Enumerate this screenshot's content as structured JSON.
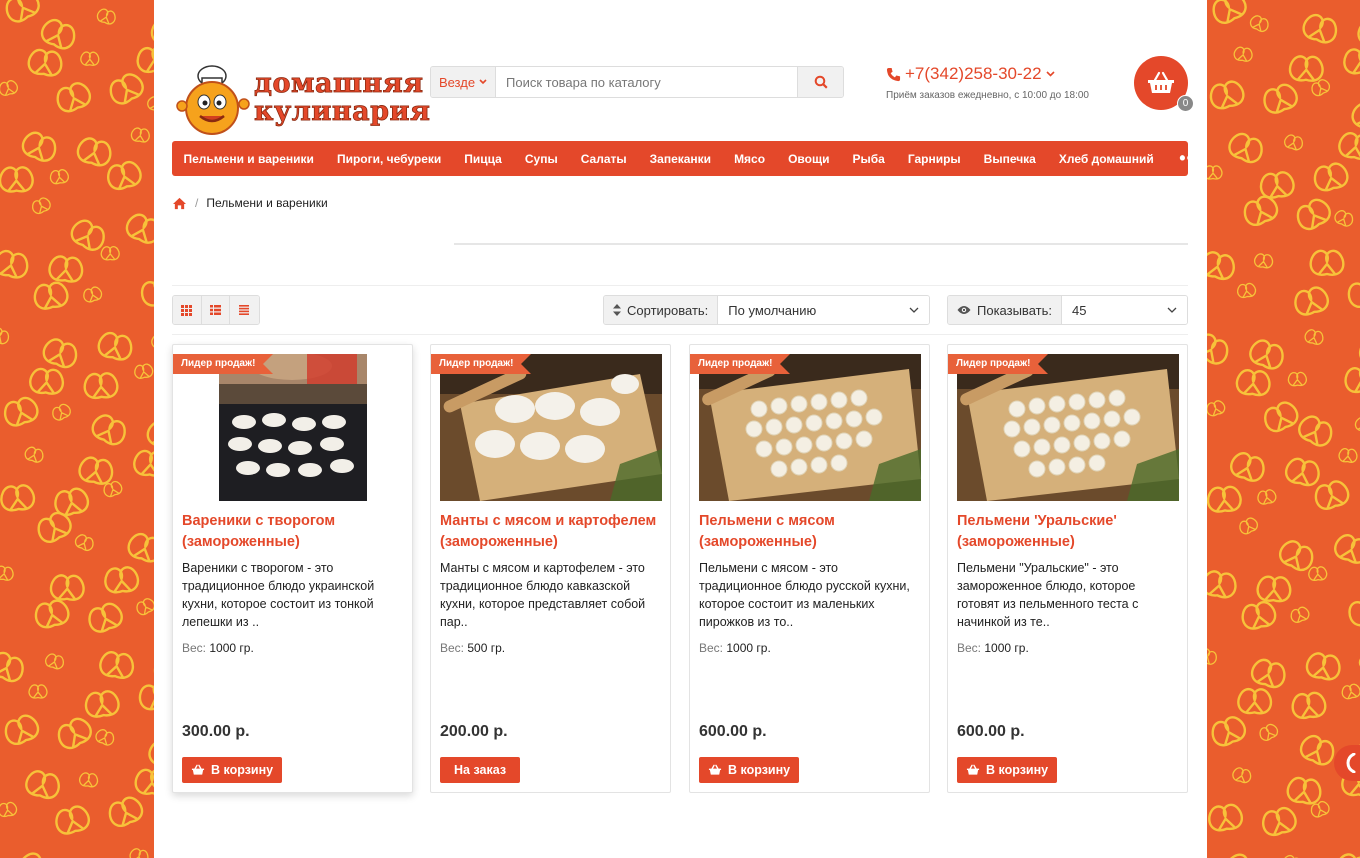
{
  "brand": {
    "logo_line1": "домашняя",
    "logo_line2": "кулинария",
    "accent_color": "#e4482a",
    "background_color": "#ea5d2d"
  },
  "search": {
    "scope": "Везде",
    "placeholder": "Поиск товара по каталогу",
    "icon": "search-icon"
  },
  "contact": {
    "phone": "+7(342)258-30-22",
    "hours": "Приём заказов ежедневно, с 10:00 до 18:00"
  },
  "cart": {
    "count": "0",
    "icon": "basket-icon"
  },
  "menu": {
    "items": [
      "Пельмени и вареники",
      "Пироги, чебуреки",
      "Пицца",
      "Супы",
      "Салаты",
      "Запеканки",
      "Мясо",
      "Овощи",
      "Рыба",
      "Гарниры",
      "Выпечка",
      "Хлеб домашний"
    ],
    "more": "•••"
  },
  "breadcrumb": {
    "current": "Пельмени и вареники"
  },
  "toolbar": {
    "sort_label": "Сортировать:",
    "sort_value": "По умолчанию",
    "show_label": "Показывать:",
    "show_value": "45"
  },
  "products": [
    {
      "badge": "Лидер продаж!",
      "name": "Вареники с творогом (замороженные)",
      "desc": "Вареники с творогом - это традиционное блюдо украинской кухни, которое состоит из тонкой лепешки из ..",
      "weight_label": "Вес:",
      "weight": "1000 гр.",
      "price": "300.00 р.",
      "button": "В корзину"
    },
    {
      "badge": "Лидер продаж!",
      "name": "Манты с мясом и картофелем (замороженные)",
      "desc": "Манты с мясом и картофелем - это традиционное блюдо кавказской кухни, которое представляет собой пар..",
      "weight_label": "Вес:",
      "weight": "500 гр.",
      "price": "200.00 р.",
      "button": "На заказ"
    },
    {
      "badge": "Лидер продаж!",
      "name": "Пельмени с мясом (замороженные)",
      "desc": "Пельмени с мясом - это традиционное блюдо русской кухни, которое состоит из маленьких пирожков из то..",
      "weight_label": "Вес:",
      "weight": "1000 гр.",
      "price": "600.00 р.",
      "button": "В корзину"
    },
    {
      "badge": "Лидер продаж!",
      "name": "Пельмени 'Уральские' (замороженные)",
      "desc": "Пельмени \"Уральские\" - это замороженное блюдо, которое готовят из пельменного теста с начинкой из те..",
      "weight_label": "Вес:",
      "weight": "1000 гр.",
      "price": "600.00 р.",
      "button": "В корзину"
    }
  ]
}
